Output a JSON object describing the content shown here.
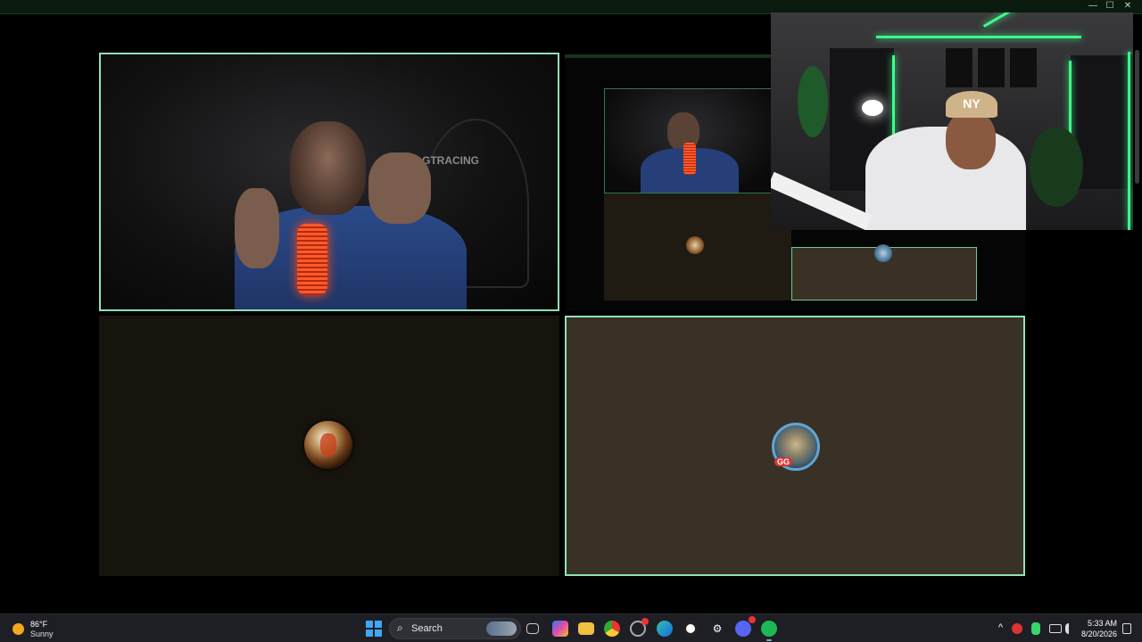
{
  "window": {
    "controls": {
      "minimize": "—",
      "maximize": "☐",
      "close": "✕"
    }
  },
  "tiles": {
    "webcam_chair_brand": "GTRACING",
    "avatar_badge": "GG"
  },
  "streamer_overlay": {
    "cap_logo": "NY"
  },
  "taskbar": {
    "weather": {
      "temp": "86°F",
      "condition": "Sunny"
    },
    "search": {
      "label": "Search"
    },
    "apps": [
      {
        "name": "task-view",
        "glyph": "▭"
      },
      {
        "name": "copilot",
        "glyph": "◆"
      },
      {
        "name": "file-explorer",
        "glyph": "▬"
      },
      {
        "name": "chrome",
        "glyph": "◉"
      },
      {
        "name": "app-badge",
        "glyph": "◌"
      },
      {
        "name": "edge",
        "glyph": "◐"
      },
      {
        "name": "obs",
        "glyph": "◍"
      },
      {
        "name": "settings",
        "glyph": "⚙"
      },
      {
        "name": "discord",
        "glyph": "◕"
      },
      {
        "name": "spotify",
        "glyph": "◉"
      }
    ],
    "tray": {
      "chevron": "^",
      "time": "5:33 AM",
      "date": "8/20/2026"
    }
  },
  "colors": {
    "active_border": "#8fe3b7",
    "taskbar_bg": "#1e1f24",
    "tile_dark": "#17130d",
    "tile_light": "#3a3126",
    "accent_green": "#3dff8a"
  }
}
